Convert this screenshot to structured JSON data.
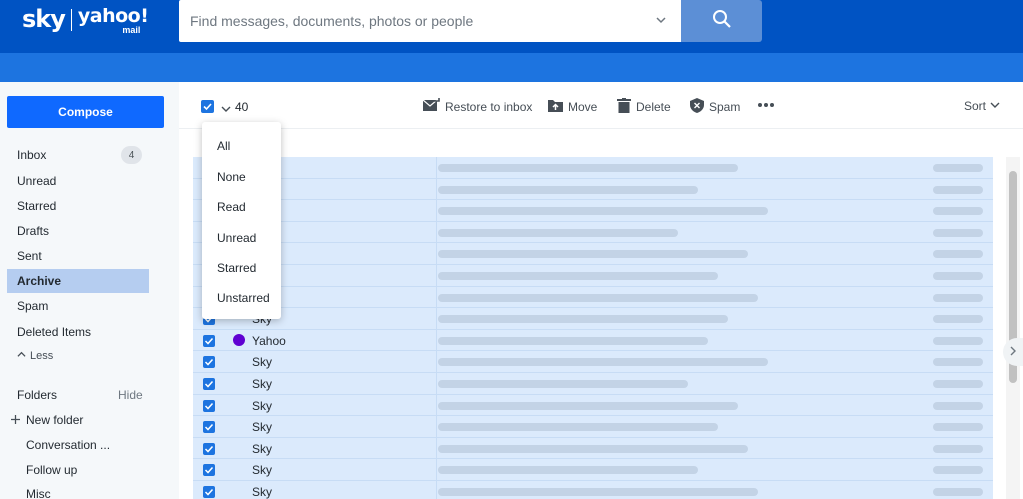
{
  "header": {
    "logo_left": "sky",
    "logo_right": "yahoo!",
    "logo_sub": "mail",
    "search_placeholder": "Find messages, documents, photos or people"
  },
  "sidebar": {
    "compose_label": "Compose",
    "items": [
      {
        "label": "Inbox",
        "badge": "4"
      },
      {
        "label": "Unread"
      },
      {
        "label": "Starred"
      },
      {
        "label": "Drafts"
      },
      {
        "label": "Sent"
      },
      {
        "label": "Archive",
        "active": true
      },
      {
        "label": "Spam"
      },
      {
        "label": "Deleted Items"
      }
    ],
    "less_label": "Less",
    "folders_label": "Folders",
    "hide_label": "Hide",
    "new_folder_label": "New folder",
    "folders": [
      "Conversation ...",
      "Follow up",
      "Misc"
    ]
  },
  "toolbar": {
    "selected_count": "40",
    "restore_label": "Restore to inbox",
    "move_label": "Move",
    "delete_label": "Delete",
    "spam_label": "Spam",
    "sort_label": "Sort"
  },
  "select_menu": {
    "options": [
      "All",
      "None",
      "Read",
      "Unread",
      "Starred",
      "Unstarred"
    ]
  },
  "messages": [
    {
      "sender": ""
    },
    {
      "sender": ""
    },
    {
      "sender": ""
    },
    {
      "sender": ""
    },
    {
      "sender": ""
    },
    {
      "sender": ""
    },
    {
      "sender": ""
    },
    {
      "sender": "Sky"
    },
    {
      "sender": "Yahoo",
      "yahoo_icon": true
    },
    {
      "sender": "Sky"
    },
    {
      "sender": "Sky"
    },
    {
      "sender": "Sky"
    },
    {
      "sender": "Sky"
    },
    {
      "sender": "Sky"
    },
    {
      "sender": "Sky"
    },
    {
      "sender": "Sky"
    }
  ],
  "colors": {
    "header_bg": "#0053c3",
    "accent": "#0f69ff",
    "selected_row": "#dbeafc",
    "active_nav": "#b5cdf0"
  }
}
